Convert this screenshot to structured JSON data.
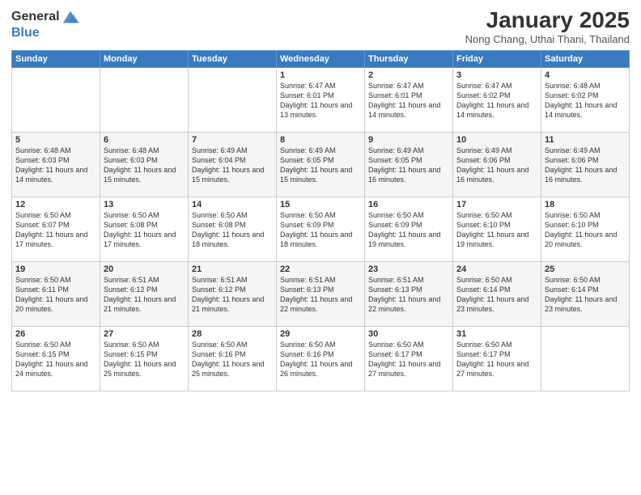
{
  "header": {
    "logo_general": "General",
    "logo_blue": "Blue",
    "month": "January 2025",
    "location": "Nong Chang, Uthai Thani, Thailand"
  },
  "weekdays": [
    "Sunday",
    "Monday",
    "Tuesday",
    "Wednesday",
    "Thursday",
    "Friday",
    "Saturday"
  ],
  "weeks": [
    [
      {
        "day": "",
        "info": ""
      },
      {
        "day": "",
        "info": ""
      },
      {
        "day": "",
        "info": ""
      },
      {
        "day": "1",
        "info": "Sunrise: 6:47 AM\nSunset: 6:01 PM\nDaylight: 11 hours and 13 minutes."
      },
      {
        "day": "2",
        "info": "Sunrise: 6:47 AM\nSunset: 6:01 PM\nDaylight: 11 hours and 14 minutes."
      },
      {
        "day": "3",
        "info": "Sunrise: 6:47 AM\nSunset: 6:02 PM\nDaylight: 11 hours and 14 minutes."
      },
      {
        "day": "4",
        "info": "Sunrise: 6:48 AM\nSunset: 6:02 PM\nDaylight: 11 hours and 14 minutes."
      }
    ],
    [
      {
        "day": "5",
        "info": "Sunrise: 6:48 AM\nSunset: 6:03 PM\nDaylight: 11 hours and 14 minutes."
      },
      {
        "day": "6",
        "info": "Sunrise: 6:48 AM\nSunset: 6:03 PM\nDaylight: 11 hours and 15 minutes."
      },
      {
        "day": "7",
        "info": "Sunrise: 6:49 AM\nSunset: 6:04 PM\nDaylight: 11 hours and 15 minutes."
      },
      {
        "day": "8",
        "info": "Sunrise: 6:49 AM\nSunset: 6:05 PM\nDaylight: 11 hours and 15 minutes."
      },
      {
        "day": "9",
        "info": "Sunrise: 6:49 AM\nSunset: 6:05 PM\nDaylight: 11 hours and 16 minutes."
      },
      {
        "day": "10",
        "info": "Sunrise: 6:49 AM\nSunset: 6:06 PM\nDaylight: 11 hours and 16 minutes."
      },
      {
        "day": "11",
        "info": "Sunrise: 6:49 AM\nSunset: 6:06 PM\nDaylight: 11 hours and 16 minutes."
      }
    ],
    [
      {
        "day": "12",
        "info": "Sunrise: 6:50 AM\nSunset: 6:07 PM\nDaylight: 11 hours and 17 minutes."
      },
      {
        "day": "13",
        "info": "Sunrise: 6:50 AM\nSunset: 6:08 PM\nDaylight: 11 hours and 17 minutes."
      },
      {
        "day": "14",
        "info": "Sunrise: 6:50 AM\nSunset: 6:08 PM\nDaylight: 11 hours and 18 minutes."
      },
      {
        "day": "15",
        "info": "Sunrise: 6:50 AM\nSunset: 6:09 PM\nDaylight: 11 hours and 18 minutes."
      },
      {
        "day": "16",
        "info": "Sunrise: 6:50 AM\nSunset: 6:09 PM\nDaylight: 11 hours and 19 minutes."
      },
      {
        "day": "17",
        "info": "Sunrise: 6:50 AM\nSunset: 6:10 PM\nDaylight: 11 hours and 19 minutes."
      },
      {
        "day": "18",
        "info": "Sunrise: 6:50 AM\nSunset: 6:10 PM\nDaylight: 11 hours and 20 minutes."
      }
    ],
    [
      {
        "day": "19",
        "info": "Sunrise: 6:50 AM\nSunset: 6:11 PM\nDaylight: 11 hours and 20 minutes."
      },
      {
        "day": "20",
        "info": "Sunrise: 6:51 AM\nSunset: 6:12 PM\nDaylight: 11 hours and 21 minutes."
      },
      {
        "day": "21",
        "info": "Sunrise: 6:51 AM\nSunset: 6:12 PM\nDaylight: 11 hours and 21 minutes."
      },
      {
        "day": "22",
        "info": "Sunrise: 6:51 AM\nSunset: 6:13 PM\nDaylight: 11 hours and 22 minutes."
      },
      {
        "day": "23",
        "info": "Sunrise: 6:51 AM\nSunset: 6:13 PM\nDaylight: 11 hours and 22 minutes."
      },
      {
        "day": "24",
        "info": "Sunrise: 6:50 AM\nSunset: 6:14 PM\nDaylight: 11 hours and 23 minutes."
      },
      {
        "day": "25",
        "info": "Sunrise: 6:50 AM\nSunset: 6:14 PM\nDaylight: 11 hours and 23 minutes."
      }
    ],
    [
      {
        "day": "26",
        "info": "Sunrise: 6:50 AM\nSunset: 6:15 PM\nDaylight: 11 hours and 24 minutes."
      },
      {
        "day": "27",
        "info": "Sunrise: 6:50 AM\nSunset: 6:15 PM\nDaylight: 11 hours and 25 minutes."
      },
      {
        "day": "28",
        "info": "Sunrise: 6:50 AM\nSunset: 6:16 PM\nDaylight: 11 hours and 25 minutes."
      },
      {
        "day": "29",
        "info": "Sunrise: 6:50 AM\nSunset: 6:16 PM\nDaylight: 11 hours and 26 minutes."
      },
      {
        "day": "30",
        "info": "Sunrise: 6:50 AM\nSunset: 6:17 PM\nDaylight: 11 hours and 27 minutes."
      },
      {
        "day": "31",
        "info": "Sunrise: 6:50 AM\nSunset: 6:17 PM\nDaylight: 11 hours and 27 minutes."
      },
      {
        "day": "",
        "info": ""
      }
    ]
  ]
}
